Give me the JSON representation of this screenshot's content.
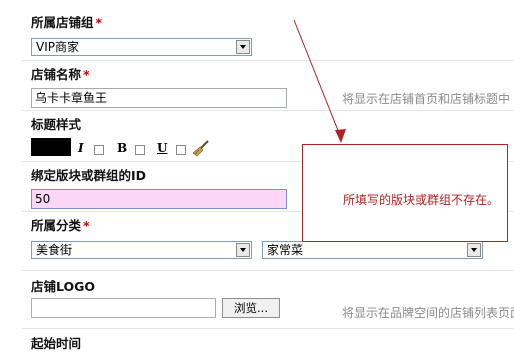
{
  "form": {
    "group": {
      "label": "所属店铺组",
      "required": "*",
      "value": "VIP商家"
    },
    "name": {
      "label": "店铺名称",
      "required": "*",
      "value": "乌卡卡章鱼王",
      "hint": "将显示在店铺首页和店铺标题中"
    },
    "title_style": {
      "label": "标题样式",
      "color": "#000000",
      "italic": "I",
      "bold": "B",
      "underline": "U"
    },
    "block_id": {
      "label": "绑定版块或群组的ID",
      "value": "50"
    },
    "category": {
      "label": "所属分类",
      "required": "*",
      "primary": "美食街",
      "secondary": "家常菜"
    },
    "logo": {
      "label": "店铺LOGO",
      "browse_label": "浏览...",
      "hint": "将显示在品牌空间的店铺列表页面"
    },
    "start_time": {
      "label": "起始时间"
    }
  },
  "error": {
    "message": "所填写的版块或群组不存在。",
    "color": "#b22222"
  },
  "colors": {
    "border_input": "#7f9db9",
    "pink_input": "#fbd7f5",
    "required": "#d00000",
    "hint": "#8a8a8a"
  }
}
